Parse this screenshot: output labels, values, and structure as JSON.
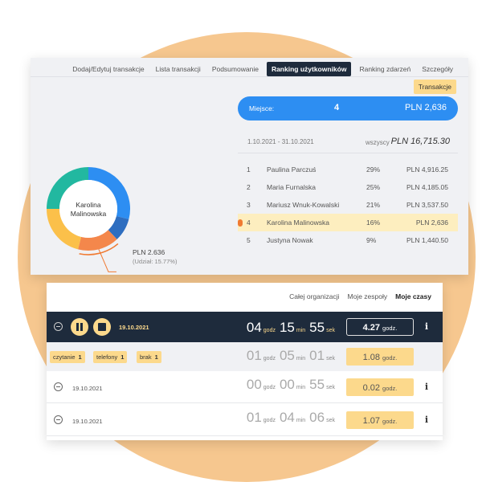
{
  "ranking_card": {
    "tabs": [
      {
        "label": "Dodaj/Edytuj transakcje"
      },
      {
        "label": "Lista transakcji"
      },
      {
        "label": "Podsumowanie"
      },
      {
        "label": "Ranking użytkowników",
        "active": true
      },
      {
        "label": "Ranking zdarzeń"
      },
      {
        "label": "Szczegóły"
      }
    ],
    "transactions_button": "Transakcje",
    "place_bar": {
      "label": "Miejsce:",
      "value": "4",
      "amount": "PLN 2,636",
      "color": "#2d8ef2"
    },
    "date_range": "1.10.2021   -   31.10.2021",
    "all_label": "wszyscy",
    "all_total": "PLN 16,715.30",
    "ranking": [
      {
        "pos": "1",
        "name": "Paulina Parczuś",
        "pct": "29%",
        "amount": "PLN 4,916.25"
      },
      {
        "pos": "2",
        "name": "Maria Furnalska",
        "pct": "25%",
        "amount": "PLN 4,185.05"
      },
      {
        "pos": "3",
        "name": "Mariusz Wnuk-Kowalski",
        "pct": "21%",
        "amount": "PLN 3,537.50"
      },
      {
        "pos": "4",
        "name": "Karolina Malinowska",
        "pct": "16%",
        "amount": "PLN 2,636",
        "highlighted": true
      },
      {
        "pos": "5",
        "name": "Justyna Nowak",
        "pct": "9%",
        "amount": "PLN 1,440.50"
      }
    ],
    "donut": {
      "center_line1": "Karolina",
      "center_line2": "Malinowska",
      "highlight_amount": "PLN 2.636",
      "highlight_share": "(Udział: 15.77%)",
      "segments": [
        {
          "value": 29,
          "color": "#2d8ef2"
        },
        {
          "value": 9,
          "color": "#2e6ec0"
        },
        {
          "value": 16,
          "color": "#f4874b"
        },
        {
          "value": 21,
          "color": "#fbc04a"
        },
        {
          "value": 25,
          "color": "#22b8a0"
        }
      ],
      "highlight_color": "#f07a32"
    }
  },
  "time_card": {
    "links": [
      {
        "label": "Całej organizacji"
      },
      {
        "label": "Moje zespoły"
      },
      {
        "label": "Moje czasy",
        "active": true
      }
    ],
    "active_timer": {
      "date": "19.10.2021",
      "hours": "04",
      "hours_unit": "godz",
      "minutes": "15",
      "minutes_unit": "min",
      "seconds": "55",
      "seconds_unit": "sek",
      "total": "4.27",
      "total_unit": "godz."
    },
    "tags": [
      {
        "name": "czytanie",
        "count": "1"
      },
      {
        "name": "telefony",
        "count": "1"
      },
      {
        "name": "brak",
        "count": "1"
      }
    ],
    "tags_time": {
      "hours": "01",
      "hours_unit": "godz",
      "minutes": "05",
      "minutes_unit": "min",
      "seconds": "01",
      "seconds_unit": "sek",
      "total": "1.08",
      "total_unit": "godz."
    },
    "entries": [
      {
        "date": "19.10.2021",
        "hours": "00",
        "hours_unit": "godz",
        "minutes": "00",
        "minutes_unit": "min",
        "seconds": "55",
        "seconds_unit": "sek",
        "total": "0.02",
        "total_unit": "godz."
      },
      {
        "date": "19.10.2021",
        "hours": "01",
        "hours_unit": "godz",
        "minutes": "04",
        "minutes_unit": "min",
        "seconds": "06",
        "seconds_unit": "sek",
        "total": "1.07",
        "total_unit": "godz."
      }
    ],
    "accent_color": "#fcd98c",
    "dark_color": "#1e2b3c"
  }
}
